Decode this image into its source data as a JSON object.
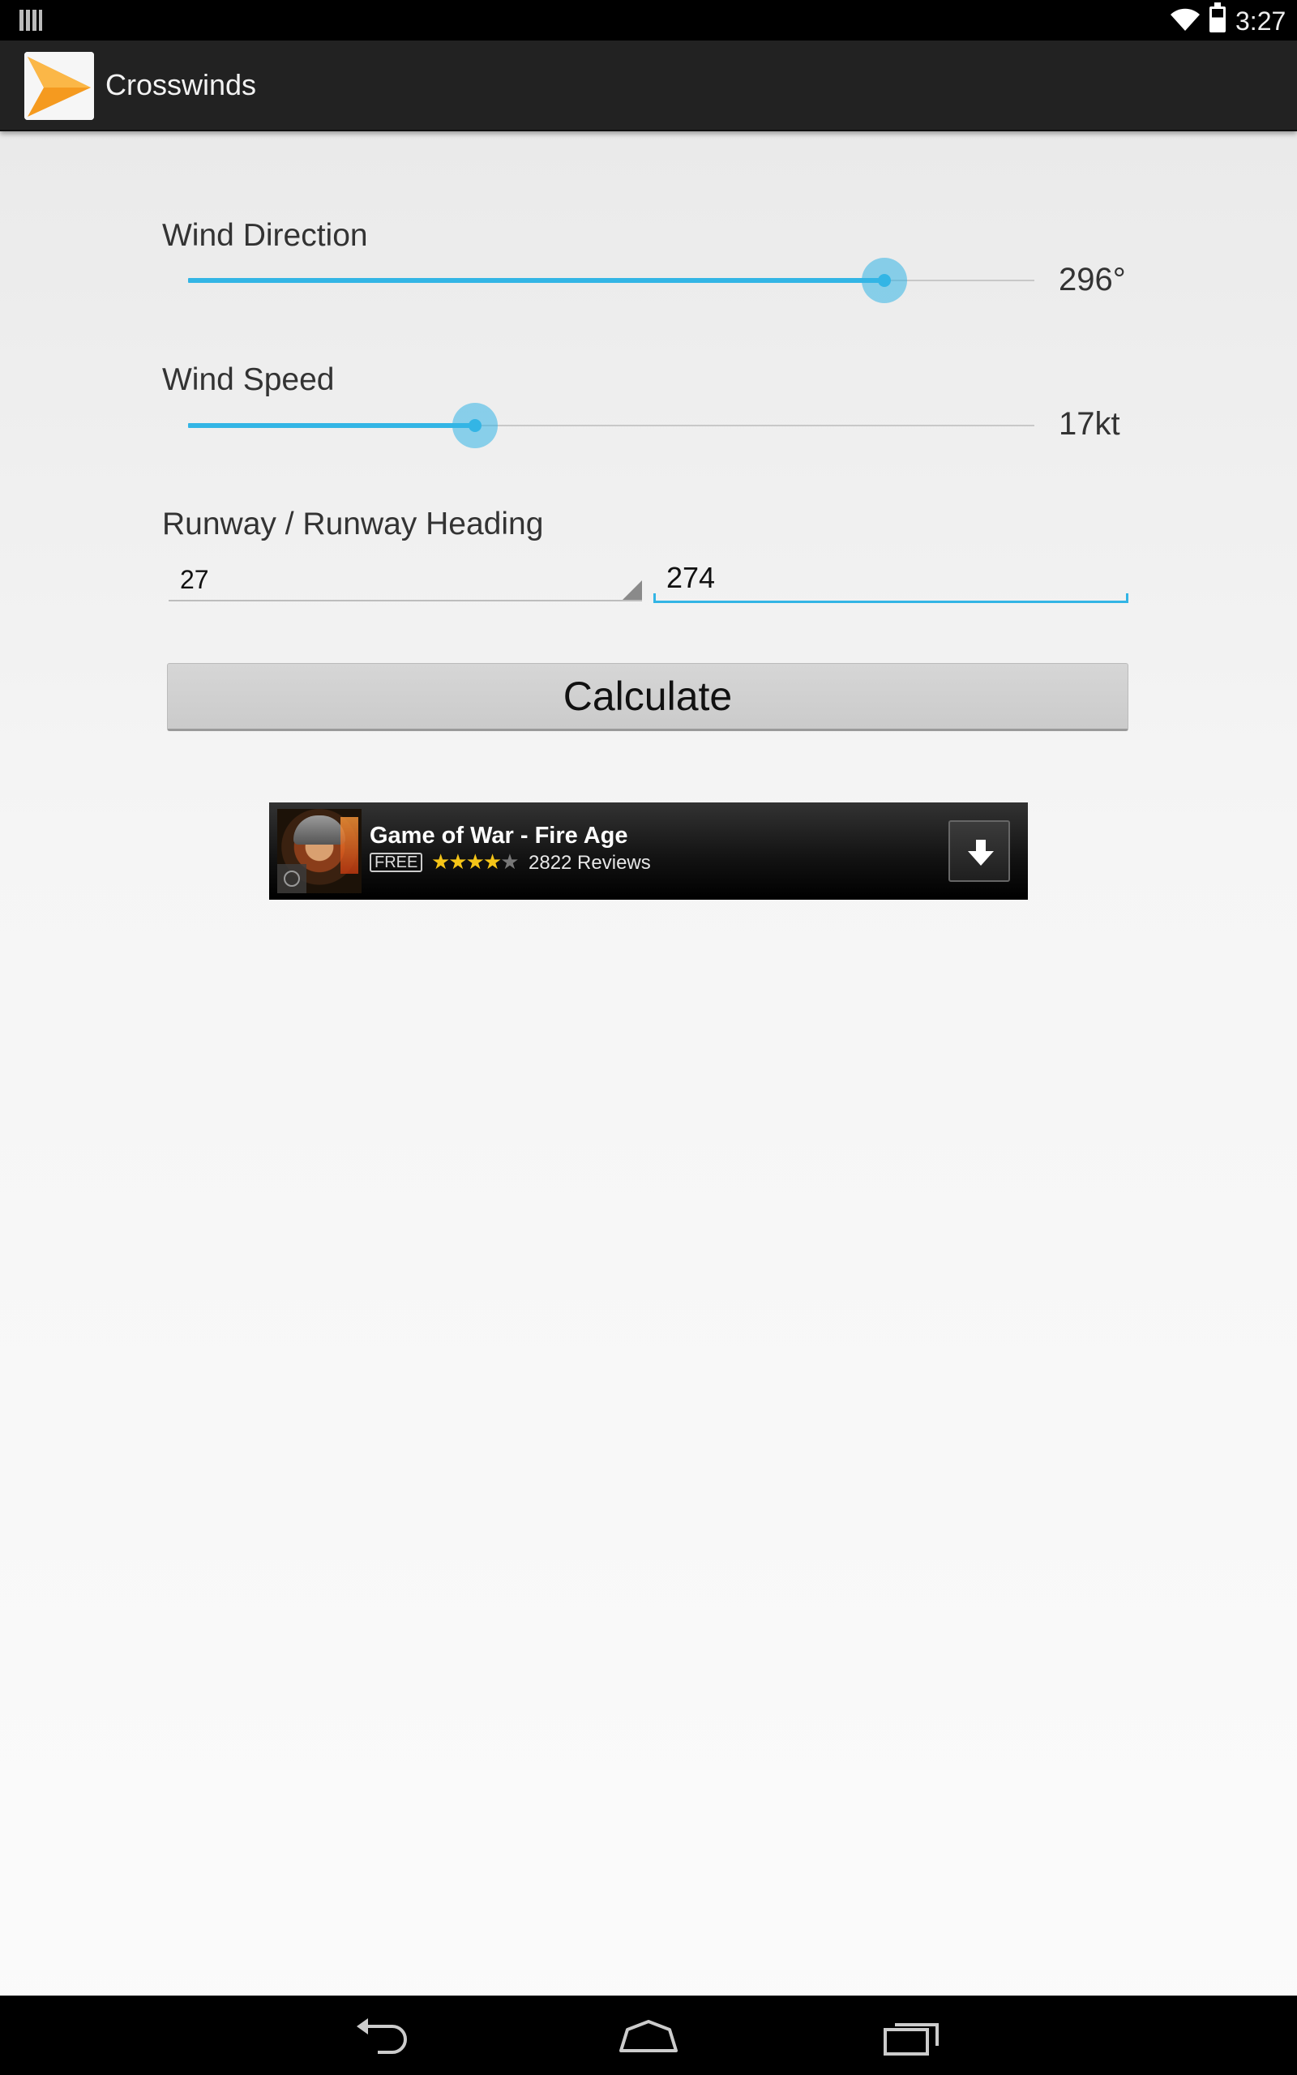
{
  "status_bar": {
    "time": "3:27"
  },
  "action_bar": {
    "title": "Crosswinds"
  },
  "wind_direction": {
    "label": "Wind Direction",
    "value_text": "296°",
    "fraction": 0.823
  },
  "wind_speed": {
    "label": "Wind Speed",
    "value_text": "17kt",
    "fraction": 0.339
  },
  "runway": {
    "label": "Runway / Runway Heading",
    "selected": "27",
    "heading_value": "274"
  },
  "calculate": {
    "label": "Calculate"
  },
  "ad": {
    "title": "Game of War - Fire Age",
    "badge": "FREE",
    "stars_filled": "★★★★",
    "stars_empty": "★",
    "rating_of_5": 4,
    "reviews": "2822 Reviews"
  },
  "colors": {
    "accent": "#33b5e5",
    "action_bar": "#222222"
  }
}
